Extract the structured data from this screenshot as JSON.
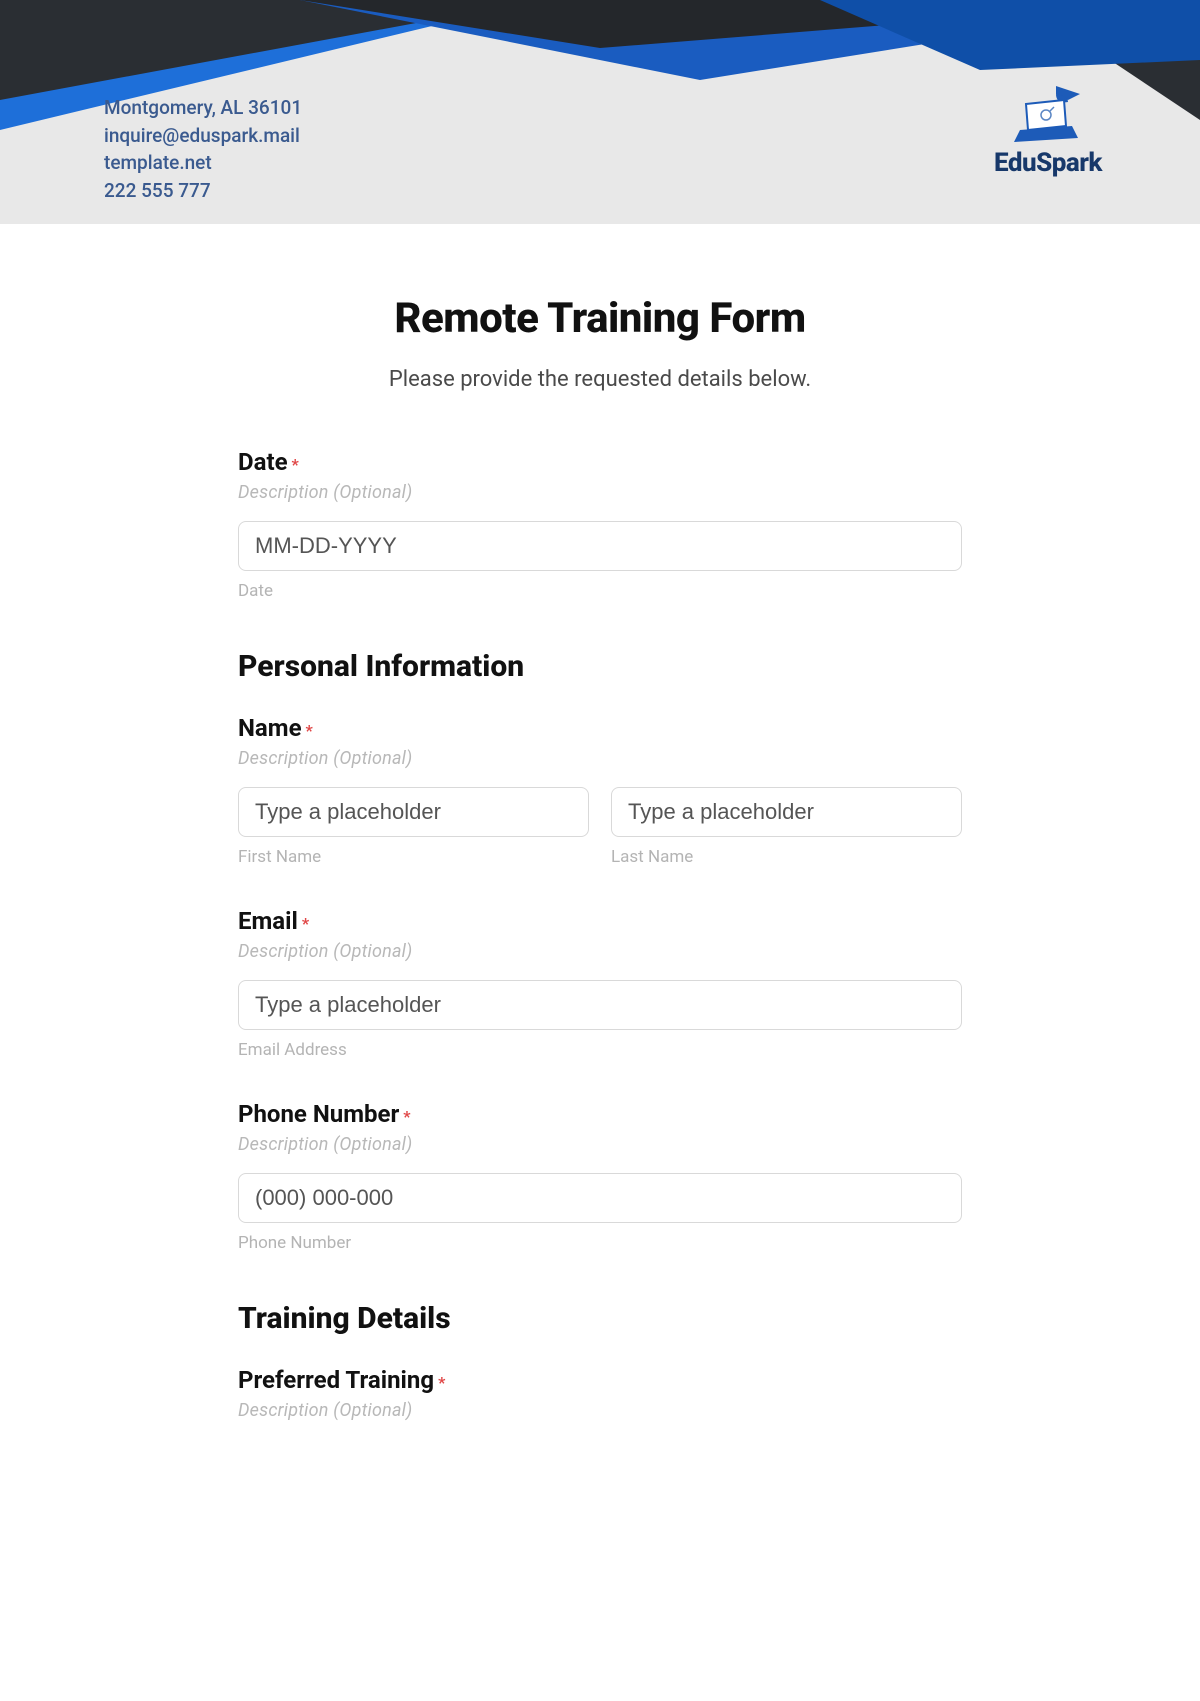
{
  "header": {
    "contact_address": "Montgomery, AL 36101",
    "contact_email": "inquire@eduspark.mail",
    "contact_site": "template.net",
    "contact_phone": "222 555 777",
    "brand": "EduSpark"
  },
  "form": {
    "title": "Remote Training Form",
    "subtitle": "Please provide the requested details below.",
    "date": {
      "label": "Date",
      "description": "Description (Optional)",
      "placeholder": "MM-DD-YYYY",
      "sublabel": "Date"
    },
    "section_personal": "Personal Information",
    "name": {
      "label": "Name",
      "description": "Description (Optional)",
      "first_placeholder": "Type a placeholder",
      "first_sublabel": "First Name",
      "last_placeholder": "Type a placeholder",
      "last_sublabel": "Last Name"
    },
    "email": {
      "label": "Email",
      "description": "Description (Optional)",
      "placeholder": "Type a placeholder",
      "sublabel": "Email Address"
    },
    "phone": {
      "label": "Phone Number",
      "description": "Description (Optional)",
      "placeholder": "(000) 000-000",
      "sublabel": "Phone Number"
    },
    "section_training": "Training Details",
    "preferred": {
      "label": "Preferred Training",
      "description": "Description (Optional)"
    }
  }
}
